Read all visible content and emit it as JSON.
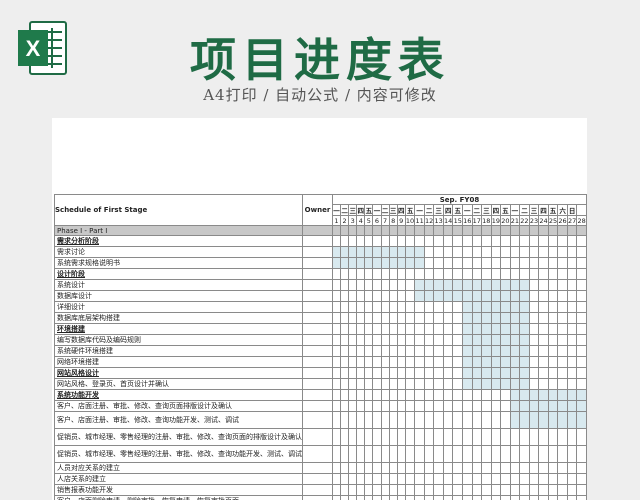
{
  "header": {
    "title": "项目进度表",
    "subtitle": "A4打印 / 自动公式 / 内容可修改",
    "logo_letter": "X",
    "brand_color": "#1f6b45",
    "icon": "excel-icon"
  },
  "sheet": {
    "schedule_label": "Schedule of First Stage",
    "owner_label": "Owner",
    "month_label": "Sep. FY08",
    "weekdays": [
      "一",
      "二",
      "三",
      "四",
      "五",
      "一",
      "二",
      "三",
      "四",
      "五",
      "一",
      "二",
      "三",
      "四",
      "五",
      "一",
      "二",
      "三",
      "四",
      "五",
      "一",
      "二",
      "三",
      "四",
      "五",
      "六",
      "日"
    ],
    "days": [
      "1",
      "2",
      "3",
      "4",
      "5",
      "6",
      "7",
      "8",
      "9",
      "10",
      "11",
      "12",
      "13",
      "14",
      "15",
      "16",
      "17",
      "18",
      "19",
      "20",
      "21",
      "22",
      "23",
      "24",
      "25",
      "26",
      "27",
      "28"
    ],
    "rows": [
      {
        "label": "Phase I - Part I",
        "type": "phase",
        "shade": []
      },
      {
        "label": "需求分析阶段",
        "type": "stage",
        "shade": []
      },
      {
        "label": "需求讨论",
        "type": "task",
        "shade": [
          1,
          11
        ]
      },
      {
        "label": "系统需求规格说明书",
        "type": "task",
        "shade": [
          1,
          11
        ]
      },
      {
        "label": "设计阶段",
        "type": "stage",
        "shade": []
      },
      {
        "label": "系统设计",
        "type": "task",
        "shade": [
          11,
          22
        ]
      },
      {
        "label": "数据库设计",
        "type": "task",
        "shade": [
          11,
          22
        ]
      },
      {
        "label": "详细设计",
        "type": "task",
        "shade": [
          16,
          22
        ]
      },
      {
        "label": "数据库底层架构搭建",
        "type": "task",
        "shade": [
          16,
          22
        ]
      },
      {
        "label": "环境搭建",
        "type": "stage",
        "shade": [
          16,
          22
        ]
      },
      {
        "label": "编写数据库代码及编码规则",
        "type": "task",
        "shade": [
          16,
          22
        ]
      },
      {
        "label": "系统硬件环境搭建",
        "type": "task",
        "shade": [
          16,
          22
        ]
      },
      {
        "label": "网络环境搭建",
        "type": "task",
        "shade": [
          16,
          22
        ]
      },
      {
        "label": "网站风格设计",
        "type": "stage",
        "shade": [
          16,
          22
        ]
      },
      {
        "label": "网站风格、登录页、首页设计并确认",
        "type": "task",
        "shade": [
          16,
          22
        ]
      },
      {
        "label": "系统功能开发",
        "type": "stage",
        "shade": [
          21,
          28
        ]
      },
      {
        "label": "客户、店面注册、审批、修改、查询页面排版设计及确认",
        "type": "task",
        "shade": [
          21,
          28
        ]
      },
      {
        "label": "客户、店面注册、审批、修改、查询功能开发、测试、调试",
        "type": "task2",
        "shade": [
          21,
          28
        ]
      },
      {
        "label": "促销员、城市经理、零售经理的注册、审批、修改、查询页面的排版设计及确认",
        "type": "task2",
        "shade": []
      },
      {
        "label": "促销员、城市经理、零售经理的注册、审批、修改、查询功能开发、测试、调试",
        "type": "task2",
        "shade": []
      },
      {
        "label": "人员对应关系的建立",
        "type": "task",
        "shade": []
      },
      {
        "label": "人店关系的建立",
        "type": "task",
        "shade": []
      },
      {
        "label": "销售报表功能开发",
        "type": "task",
        "shade": []
      },
      {
        "label": "客户、店面删除申请、删除审批、恢复申请、恢复审批页面",
        "type": "task",
        "shade": []
      }
    ]
  }
}
